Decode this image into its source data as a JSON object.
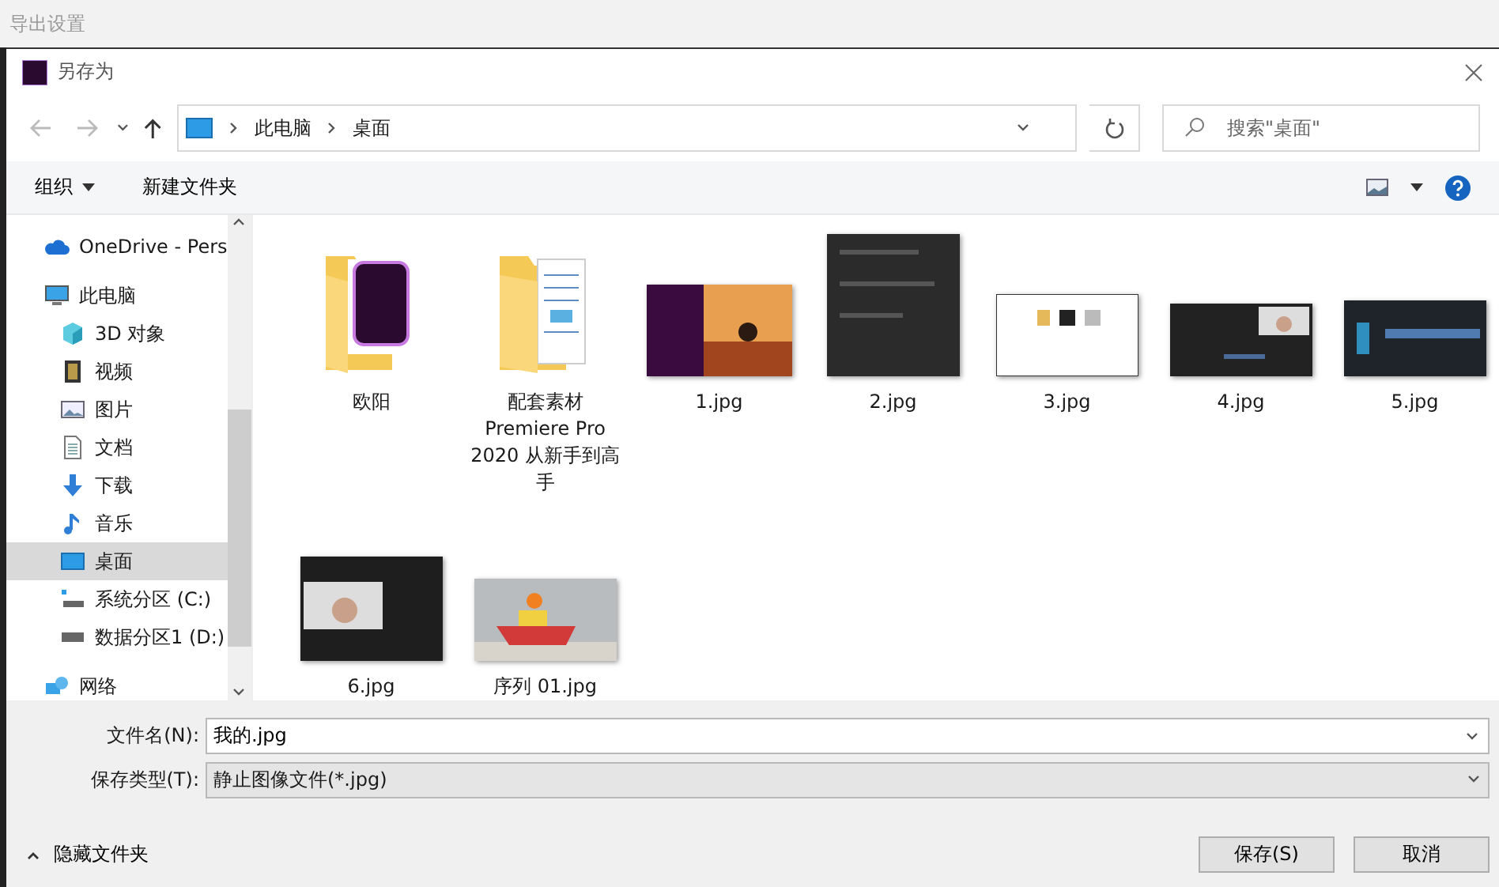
{
  "background_window": {
    "title": "导出设置"
  },
  "dialog": {
    "title": "另存为",
    "address": [
      "此电脑",
      "桌面"
    ],
    "search": {
      "placeholder": "搜索\"桌面\""
    },
    "toolbar": [
      {
        "label": "组织",
        "kind": "menu"
      },
      {
        "label": "新建文件夹",
        "kind": "button"
      }
    ],
    "sidebar": [
      {
        "label": "OneDrive - Pers",
        "selected": false
      },
      {
        "label": "此电脑",
        "selected": false,
        "children": [
          {
            "label": "3D 对象",
            "selected": false
          },
          {
            "label": "视频",
            "selected": false
          },
          {
            "label": "图片",
            "selected": false
          },
          {
            "label": "文档",
            "selected": false
          },
          {
            "label": "下载",
            "selected": false
          },
          {
            "label": "音乐",
            "selected": false
          },
          {
            "label": "桌面",
            "selected": true
          },
          {
            "label": "系统分区 (C:)",
            "selected": false
          },
          {
            "label": "数据分区1 (D:)",
            "selected": false
          }
        ]
      },
      {
        "label": "网络",
        "selected": false
      }
    ],
    "files": [
      {
        "name": "欧阳",
        "kind": "project-folder"
      },
      {
        "name": "配套素材 Premiere Pro 2020 从新手到高手",
        "kind": "folder"
      },
      {
        "name": "1.jpg",
        "kind": "picture"
      },
      {
        "name": "2.jpg",
        "kind": "picture"
      },
      {
        "name": "3.jpg",
        "kind": "picture"
      },
      {
        "name": "4.jpg",
        "kind": "picture"
      },
      {
        "name": "5.jpg",
        "kind": "picture"
      },
      {
        "name": "6.jpg",
        "kind": "picture"
      },
      {
        "name": "序列 01.jpg",
        "kind": "picture"
      }
    ],
    "file_name": {
      "label": "文件名(N):",
      "value": "我的.jpg"
    },
    "save_type": {
      "label": "保存类型(T):",
      "value": "静止图像文件(*.jpg)"
    },
    "hide_folders": {
      "label": "隐藏文件夹",
      "expanded": true
    },
    "buttons": [
      "保存(S)",
      "取消"
    ]
  }
}
